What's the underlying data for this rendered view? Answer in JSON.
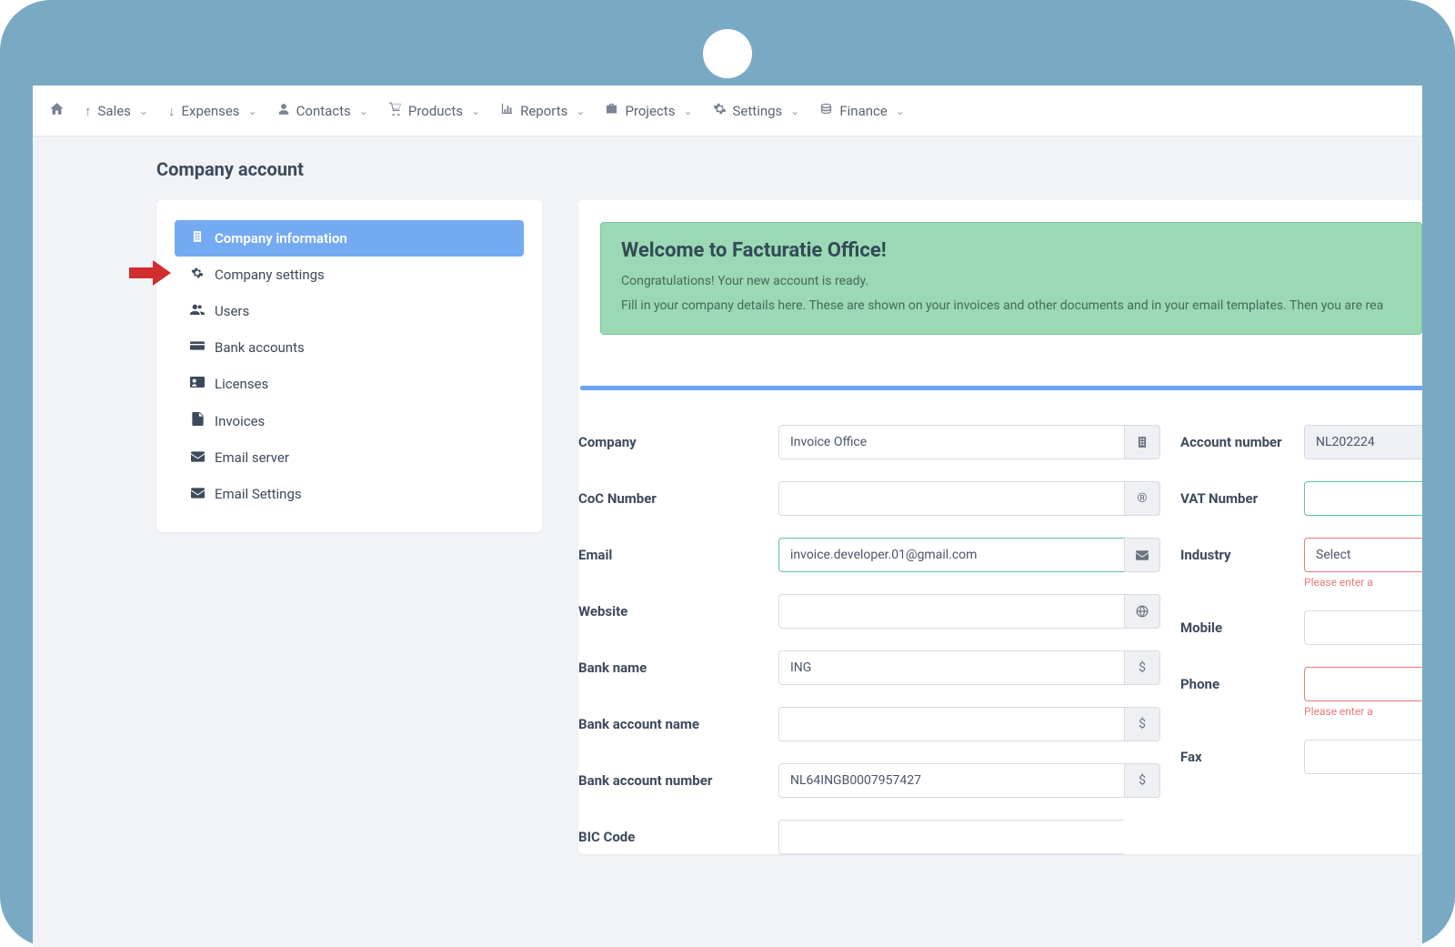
{
  "nav": {
    "items": [
      {
        "label": "Sales"
      },
      {
        "label": "Expenses"
      },
      {
        "label": "Contacts"
      },
      {
        "label": "Products"
      },
      {
        "label": "Reports"
      },
      {
        "label": "Projects"
      },
      {
        "label": "Settings"
      },
      {
        "label": "Finance"
      }
    ]
  },
  "page": {
    "title": "Company account"
  },
  "sidenav": {
    "items": [
      {
        "label": "Company information"
      },
      {
        "label": "Company settings"
      },
      {
        "label": "Users"
      },
      {
        "label": "Bank accounts"
      },
      {
        "label": "Licenses"
      },
      {
        "label": "Invoices"
      },
      {
        "label": "Email server"
      },
      {
        "label": "Email Settings"
      }
    ]
  },
  "alert": {
    "title": "Welcome to Facturatie Office!",
    "line1": "Congratulations! Your new account is ready.",
    "line2": "Fill in your company details here. These are shown on your invoices and other documents and in your email templates. Then you are rea"
  },
  "form": {
    "left": {
      "company": {
        "label": "Company",
        "value": "Invoice Office"
      },
      "coc": {
        "label": "CoC Number",
        "value": ""
      },
      "email": {
        "label": "Email",
        "value": "invoice.developer.01@gmail.com"
      },
      "website": {
        "label": "Website",
        "value": ""
      },
      "bank_name": {
        "label": "Bank name",
        "value": "ING"
      },
      "bank_account_name": {
        "label": "Bank account name",
        "value": ""
      },
      "bank_account_number": {
        "label": "Bank account number",
        "value": "NL64INGB0007957427"
      },
      "bic": {
        "label": "BIC Code",
        "value": ""
      }
    },
    "right": {
      "account_number": {
        "label": "Account number",
        "value": "NL202224"
      },
      "vat": {
        "label": "VAT Number",
        "value": ""
      },
      "industry": {
        "label": "Industry",
        "value": "Select",
        "error": "Please enter a"
      },
      "mobile": {
        "label": "Mobile",
        "value": ""
      },
      "phone": {
        "label": "Phone",
        "value": "",
        "error": "Please enter a"
      },
      "fax": {
        "label": "Fax",
        "value": ""
      }
    }
  }
}
